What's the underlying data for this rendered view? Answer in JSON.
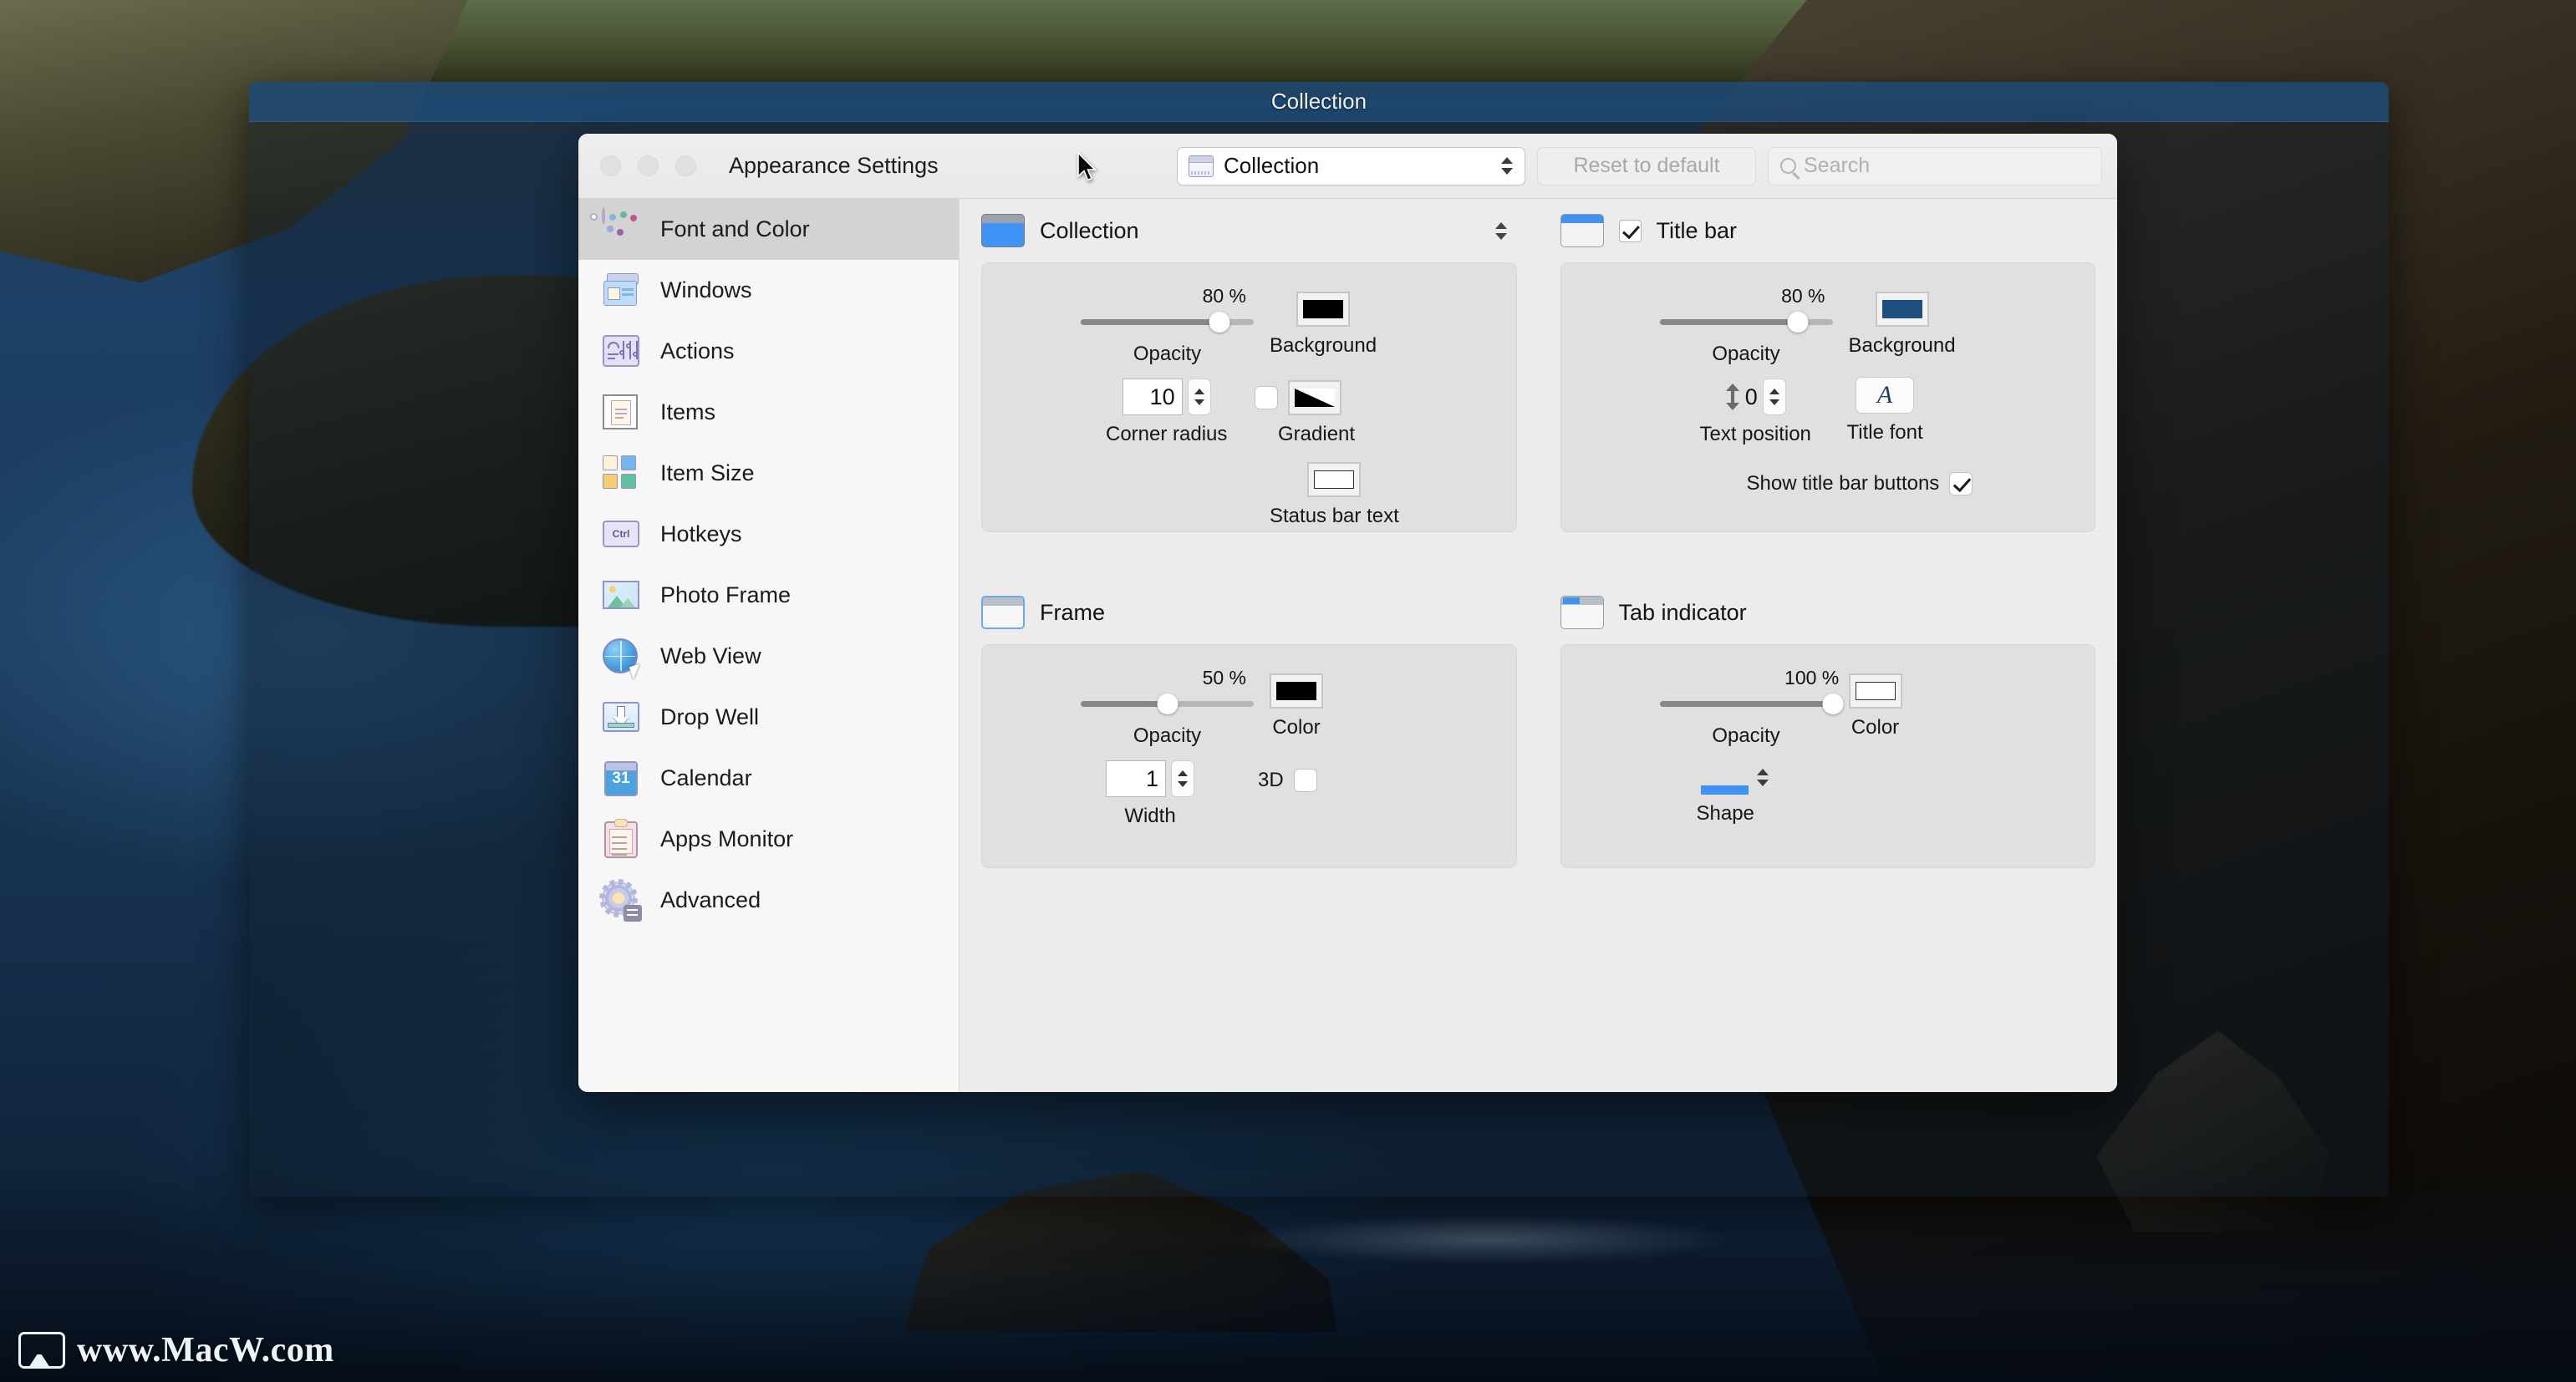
{
  "desktop": {
    "watermark": "www.MacW.com"
  },
  "collection_window": {
    "title": "Collection"
  },
  "settings_window": {
    "title": "Appearance Settings",
    "traffic_lights": [
      "close-button",
      "minimize-button",
      "zoom-button"
    ],
    "toolbar": {
      "popup": {
        "label": "Collection",
        "icon": "window-icon"
      },
      "reset_label": "Reset to default",
      "search": {
        "placeholder": "Search",
        "value": ""
      }
    },
    "sidebar": {
      "items": [
        {
          "label": "Font and Color",
          "icon": "palette-icon",
          "selected": true
        },
        {
          "label": "Windows",
          "icon": "windows-icon",
          "selected": false
        },
        {
          "label": "Actions",
          "icon": "sliders-icon",
          "selected": false
        },
        {
          "label": "Items",
          "icon": "document-icon",
          "selected": false
        },
        {
          "label": "Item Size",
          "icon": "grid-squares-icon",
          "selected": false
        },
        {
          "label": "Hotkeys",
          "icon": "ctrl-key-icon",
          "selected": false
        },
        {
          "label": "Photo Frame",
          "icon": "photo-icon",
          "selected": false
        },
        {
          "label": "Web View",
          "icon": "globe-cursor-icon",
          "selected": false
        },
        {
          "label": "Drop Well",
          "icon": "drop-arrow-icon",
          "selected": false
        },
        {
          "label": "Calendar",
          "icon": "calendar-icon",
          "selected": false
        },
        {
          "label": "Apps Monitor",
          "icon": "clipboard-icon",
          "selected": false
        },
        {
          "label": "Advanced",
          "icon": "gear-icon",
          "selected": false
        }
      ],
      "calendar_day": "31",
      "hotkey_text": "Ctrl"
    },
    "sections": {
      "collection": {
        "title": "Collection",
        "opacity": {
          "label": "Opacity",
          "value": "80 %",
          "percent": 80
        },
        "background": {
          "label": "Background",
          "color": "#000000"
        },
        "corner_radius": {
          "label": "Corner radius",
          "value": "10"
        },
        "gradient": {
          "label": "Gradient",
          "checked": false
        },
        "status_bar_text": {
          "label": "Status bar text",
          "color": "#ffffff"
        }
      },
      "title_bar": {
        "title": "Title bar",
        "enabled": true,
        "opacity": {
          "label": "Opacity",
          "value": "80 %",
          "percent": 80
        },
        "background": {
          "label": "Background",
          "color": "#1f4f80"
        },
        "text_position": {
          "label": "Text position",
          "value": "0"
        },
        "title_font": {
          "label": "Title font",
          "glyph": "A"
        },
        "show_buttons": {
          "label": "Show title bar buttons",
          "checked": true
        }
      },
      "frame": {
        "title": "Frame",
        "opacity": {
          "label": "Opacity",
          "value": "50 %",
          "percent": 50
        },
        "color": {
          "label": "Color",
          "color": "#000000"
        },
        "width": {
          "label": "Width",
          "value": "1"
        },
        "three_d": {
          "label": "3D",
          "checked": false
        }
      },
      "tab_indicator": {
        "title": "Tab indicator",
        "opacity": {
          "label": "Opacity",
          "value": "100 %",
          "percent": 100
        },
        "color": {
          "label": "Color",
          "color": "#ffffff"
        },
        "shape": {
          "label": "Shape",
          "accent": "#3f93f5"
        }
      }
    }
  },
  "colors": {
    "accent": "#3f93f5",
    "titlebar_blue": "#1f4f80",
    "window_bg": "#ececec",
    "card_bg": "#e0e0e0",
    "sidebar_bg": "#f7f7f7",
    "selected_row": "#d3d3d3"
  }
}
